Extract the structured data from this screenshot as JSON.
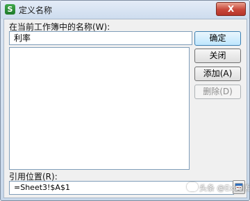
{
  "window": {
    "app_icon": "S",
    "title": "定义名称",
    "close_label": "X"
  },
  "form": {
    "name_label": "在当前工作簿中的名称(W):",
    "name_value": "利率",
    "refers_label": "引用位置(R):",
    "refers_value": "=Sheet3!$A$1"
  },
  "buttons": {
    "ok": "确定",
    "close": "关闭",
    "add": "添加(A)",
    "delete": "删除(D)"
  },
  "watermark": {
    "text": "头条 @Excel精选技巧"
  },
  "colors": {
    "title_bar": "#cddcee",
    "close_button": "#c8473a",
    "app_icon": "#2e8f3a"
  },
  "icons": {
    "app": "spreadsheet-s-icon",
    "collapse": "collapse-dialog-icon"
  }
}
